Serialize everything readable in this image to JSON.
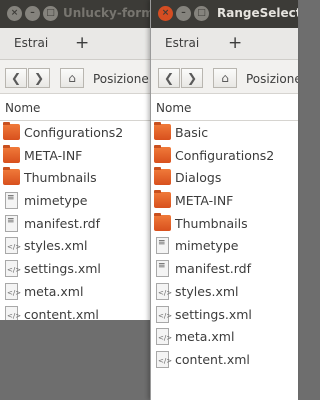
{
  "back_window": {
    "title": "Unlucky-form",
    "toolbar_label": "Estrai",
    "location_label": "Posizione",
    "column_header": "Nome",
    "files": [
      {
        "name": "Configurations2",
        "icon": "folder-icon"
      },
      {
        "name": "META-INF",
        "icon": "folder-icon"
      },
      {
        "name": "Thumbnails",
        "icon": "folder-icon"
      },
      {
        "name": "mimetype",
        "icon": "text-file-icon"
      },
      {
        "name": "manifest.rdf",
        "icon": "document-file-icon"
      },
      {
        "name": "styles.xml",
        "icon": "xml-file-icon"
      },
      {
        "name": "settings.xml",
        "icon": "xml-file-icon"
      },
      {
        "name": "meta.xml",
        "icon": "xml-file-icon"
      },
      {
        "name": "content.xml",
        "icon": "xml-file-icon"
      }
    ]
  },
  "front_window": {
    "title": "RangeSelect",
    "toolbar_label": "Estrai",
    "location_label": "Posizione",
    "column_header": "Nome",
    "files": [
      {
        "name": "Basic",
        "icon": "folder-icon"
      },
      {
        "name": "Configurations2",
        "icon": "folder-icon"
      },
      {
        "name": "Dialogs",
        "icon": "folder-icon"
      },
      {
        "name": "META-INF",
        "icon": "folder-icon"
      },
      {
        "name": "Thumbnails",
        "icon": "folder-icon"
      },
      {
        "name": "mimetype",
        "icon": "text-file-icon"
      },
      {
        "name": "manifest.rdf",
        "icon": "document-file-icon"
      },
      {
        "name": "styles.xml",
        "icon": "xml-file-icon"
      },
      {
        "name": "settings.xml",
        "icon": "xml-file-icon"
      },
      {
        "name": "meta.xml",
        "icon": "xml-file-icon"
      },
      {
        "name": "content.xml",
        "icon": "xml-file-icon"
      }
    ]
  },
  "colors": {
    "titlebar": "#3c3b37",
    "close_button": "#d44d22",
    "folder": "#e8632b",
    "back_title_text": "#77756f",
    "front_title_text": "#e6e4df"
  }
}
